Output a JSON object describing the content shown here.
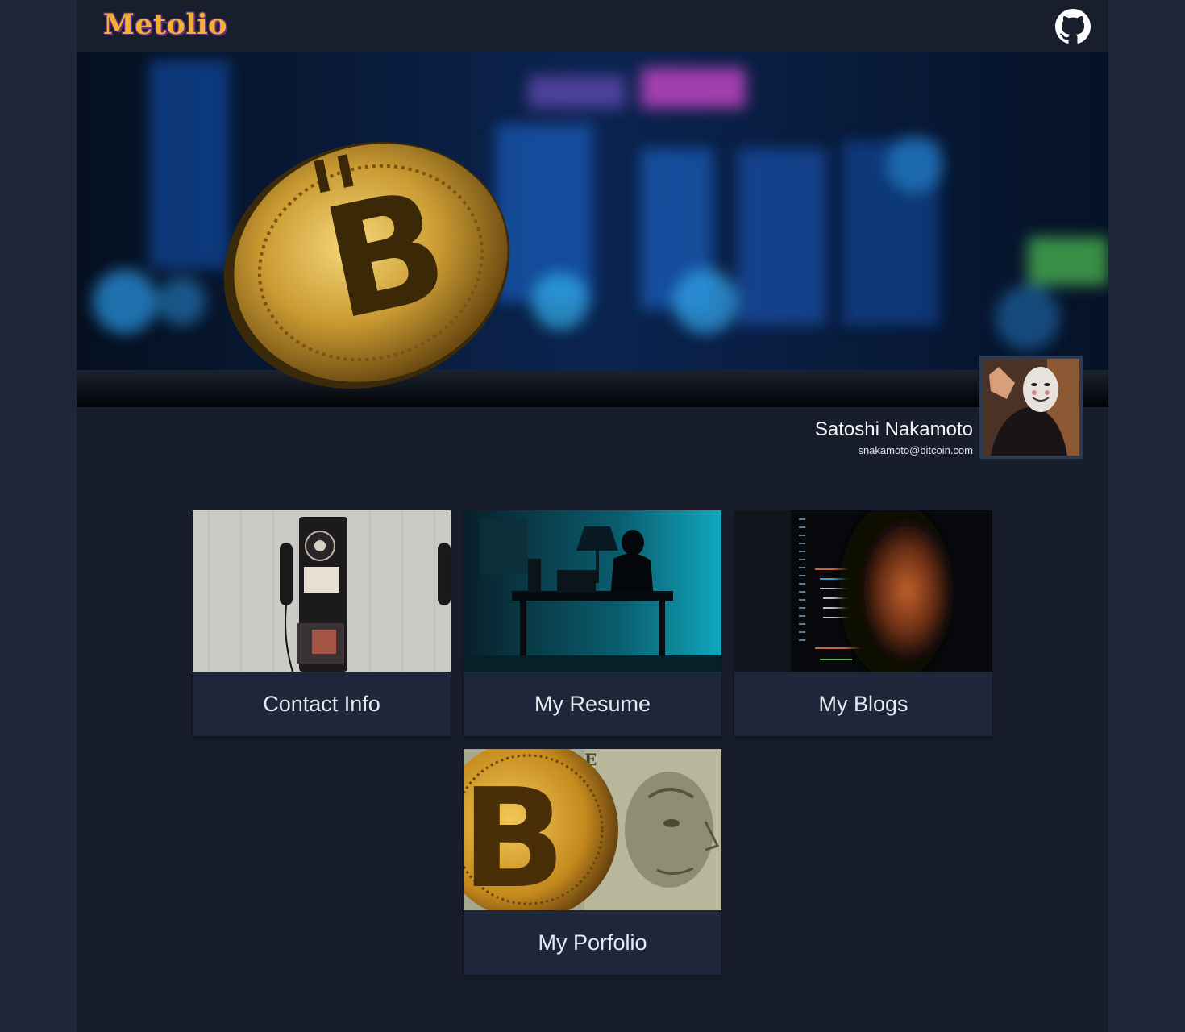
{
  "header": {
    "logo_text": "Metolio",
    "github_icon": "github-icon"
  },
  "banner": {
    "image": "bitcoin-coin-photo"
  },
  "profile": {
    "name": "Satoshi Nakamoto",
    "email": "snakamoto@bitcoin.com",
    "avatar": "masked-person-avatar"
  },
  "cards": [
    {
      "label": "Contact Info",
      "image": "payphone-photo"
    },
    {
      "label": "My Resume",
      "image": "hooded-person-at-desk-photo"
    },
    {
      "label": "My Blogs",
      "image": "code-screen-photo"
    },
    {
      "label": "My Porfolio",
      "image": "bitcoin-dollar-bill-photo"
    }
  ],
  "colors": {
    "background": "#1e2638",
    "page": "#171d2b",
    "card": "#1d2739",
    "logo": "#f0b232"
  }
}
